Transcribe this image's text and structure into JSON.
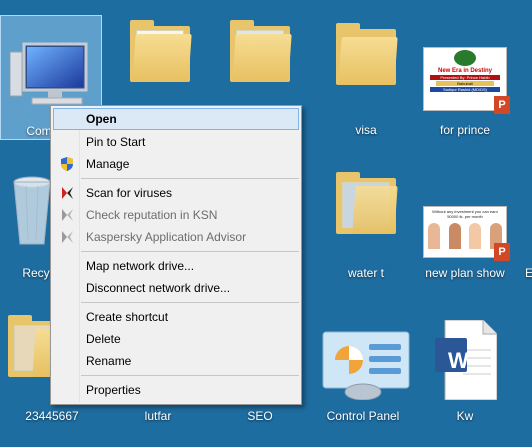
{
  "desktop": {
    "icons": [
      {
        "label": "Com"
      },
      {
        "label": "visa"
      },
      {
        "label": "for prince"
      },
      {
        "label": "Recyc"
      },
      {
        "label": "water t"
      },
      {
        "label": "new plan show"
      },
      {
        "label": "E"
      },
      {
        "label": "23445667"
      },
      {
        "label": "lutfar"
      },
      {
        "label": "SEO"
      },
      {
        "label": "Control Panel"
      },
      {
        "label": "Kw"
      }
    ],
    "thumb_for_prince": {
      "line1": "New Era in Destiny",
      "line2": "Presented By: Prince Habib",
      "line3": "Bahubali",
      "line4": "Sadiqur Rashid (MD/DS)"
    },
    "thumb_new_plan": {
      "line1": "Without any investment you can earn 50000 tk. per month"
    },
    "word_badge": "W"
  },
  "context_menu": {
    "items": [
      {
        "label": "Open"
      },
      {
        "label": "Pin to Start"
      },
      {
        "label": "Manage"
      },
      {
        "label": "Scan for viruses"
      },
      {
        "label": "Check reputation in KSN"
      },
      {
        "label": "Kaspersky Application Advisor"
      },
      {
        "label": "Map network drive..."
      },
      {
        "label": "Disconnect network drive..."
      },
      {
        "label": "Create shortcut"
      },
      {
        "label": "Delete"
      },
      {
        "label": "Rename"
      },
      {
        "label": "Properties"
      }
    ]
  }
}
